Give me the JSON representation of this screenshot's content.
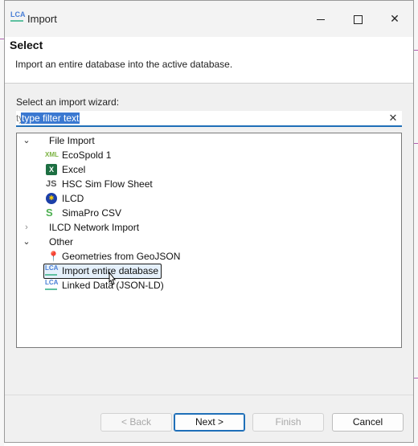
{
  "window": {
    "title": "Import",
    "icon": "openlca-icon",
    "controls": {
      "minimize": "minimize-icon",
      "maximize": "maximize-icon",
      "close": "close-icon"
    }
  },
  "header": {
    "title": "Select",
    "description": "Import an entire database into the active database."
  },
  "wizard_label": "Select an import wizard:",
  "filter": {
    "value": "type filter text",
    "placeholder": "type filter text",
    "clear_icon": "clear-icon"
  },
  "tree": {
    "groups": [
      {
        "label": "File Import",
        "expanded": true,
        "items": [
          {
            "label": "EcoSpold 1",
            "icon": "xml-icon"
          },
          {
            "label": "Excel",
            "icon": "excel-icon"
          },
          {
            "label": "HSC Sim Flow Sheet",
            "icon": "js-icon"
          },
          {
            "label": "ILCD",
            "icon": "eu-flag-icon"
          },
          {
            "label": "SimaPro CSV",
            "icon": "simapro-icon"
          }
        ]
      },
      {
        "label": "ILCD Network Import",
        "expanded": false,
        "items": []
      },
      {
        "label": "Other",
        "expanded": true,
        "items": [
          {
            "label": "Geometries from GeoJSON",
            "icon": "map-pin-icon"
          },
          {
            "label": "Import entire database",
            "icon": "openlca-icon",
            "selected": true
          },
          {
            "label": "Linked Data (JSON-LD)",
            "icon": "openlca-icon"
          }
        ]
      }
    ]
  },
  "buttons": {
    "back": "< Back",
    "next": "Next >",
    "finish": "Finish",
    "cancel": "Cancel"
  },
  "colors": {
    "accent": "#1f6fb8",
    "selection": "#3a78d1"
  }
}
